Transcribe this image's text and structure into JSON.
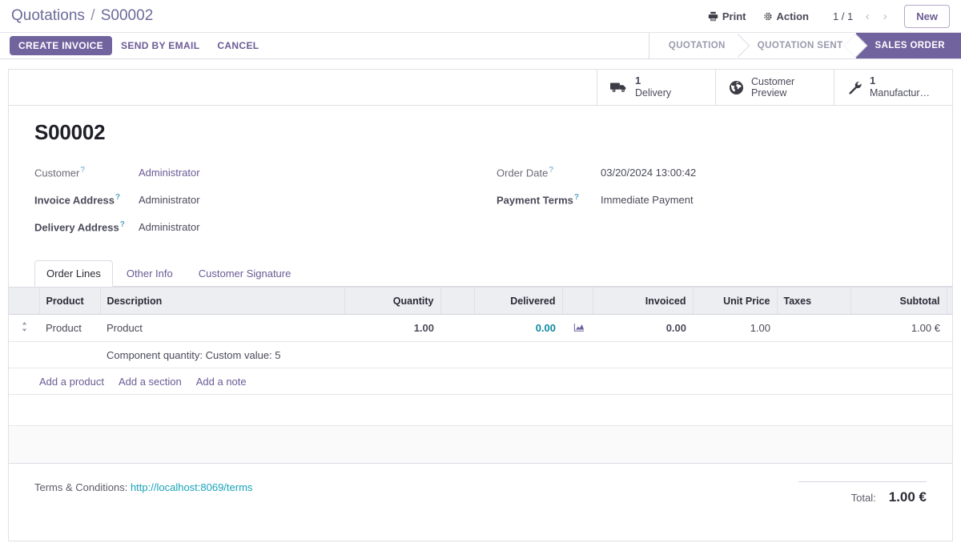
{
  "breadcrumb": {
    "root": "Quotations",
    "separator": "/",
    "current": "S00002"
  },
  "control_panel": {
    "print_label": "Print",
    "action_label": "Action",
    "pager_value": "1 / 1",
    "prev_glyph": "‹",
    "next_glyph": "›",
    "new_label": "New"
  },
  "statusbar": {
    "buttons": [
      {
        "label": "CREATE INVOICE",
        "style": "primary"
      },
      {
        "label": "SEND BY EMAIL",
        "style": "link"
      },
      {
        "label": "CANCEL",
        "style": "link"
      }
    ],
    "stages": [
      {
        "label": "QUOTATION",
        "active": false
      },
      {
        "label": "QUOTATION SENT",
        "active": false
      },
      {
        "label": "SALES ORDER",
        "active": true
      }
    ],
    "active_color": "#71639e"
  },
  "smart_buttons": [
    {
      "icon": "truck-icon",
      "value": "1",
      "label": "Delivery"
    },
    {
      "icon": "globe-icon",
      "value": "",
      "label_line1": "Customer",
      "label_line2": "Preview"
    },
    {
      "icon": "wrench-icon",
      "value": "1",
      "label": "Manufactur…"
    }
  ],
  "record": {
    "title": "S00002",
    "left_fields": [
      {
        "label": "Customer",
        "help": "?",
        "value": "Administrator",
        "bold": false,
        "link": true
      },
      {
        "label": "Invoice Address",
        "help": "?",
        "value": "Administrator",
        "bold": true,
        "link": false
      },
      {
        "label": "Delivery Address",
        "help": "?",
        "value": "Administrator",
        "bold": true,
        "link": false
      }
    ],
    "right_fields": [
      {
        "label": "Order Date",
        "help": "?",
        "value": "03/20/2024 13:00:42",
        "bold": false
      },
      {
        "label": "Payment Terms",
        "help": "?",
        "value": "Immediate Payment",
        "bold": true
      }
    ]
  },
  "notebook": {
    "tabs": [
      {
        "label": "Order Lines",
        "active": true
      },
      {
        "label": "Other Info",
        "active": false
      },
      {
        "label": "Customer Signature",
        "active": false
      }
    ]
  },
  "order_lines": {
    "columns": {
      "product": "Product",
      "description": "Description",
      "quantity": "Quantity",
      "delivered": "Delivered",
      "invoiced": "Invoiced",
      "unit_price": "Unit Price",
      "taxes": "Taxes",
      "subtotal": "Subtotal",
      "options_icon": "column-options-icon"
    },
    "rows": [
      {
        "handle_icon": "drag-handle-icon",
        "product": "Product",
        "description": "Product",
        "quantity": "1.00",
        "delivered": "0.00",
        "delivered_icon": "forecast-report-icon",
        "invoiced": "0.00",
        "unit_price": "1.00",
        "taxes": "",
        "subtotal": "1.00 €",
        "delete_icon": "trash-icon"
      }
    ],
    "note_line": "Component quantity: Custom value: 5",
    "add_links": [
      {
        "label": "Add a product"
      },
      {
        "label": "Add a section"
      },
      {
        "label": "Add a note"
      }
    ]
  },
  "footer": {
    "terms_label": "Terms & Conditions:",
    "terms_url": "http://localhost:8069/terms",
    "total_label": "Total:",
    "total_value": "1.00 €"
  }
}
